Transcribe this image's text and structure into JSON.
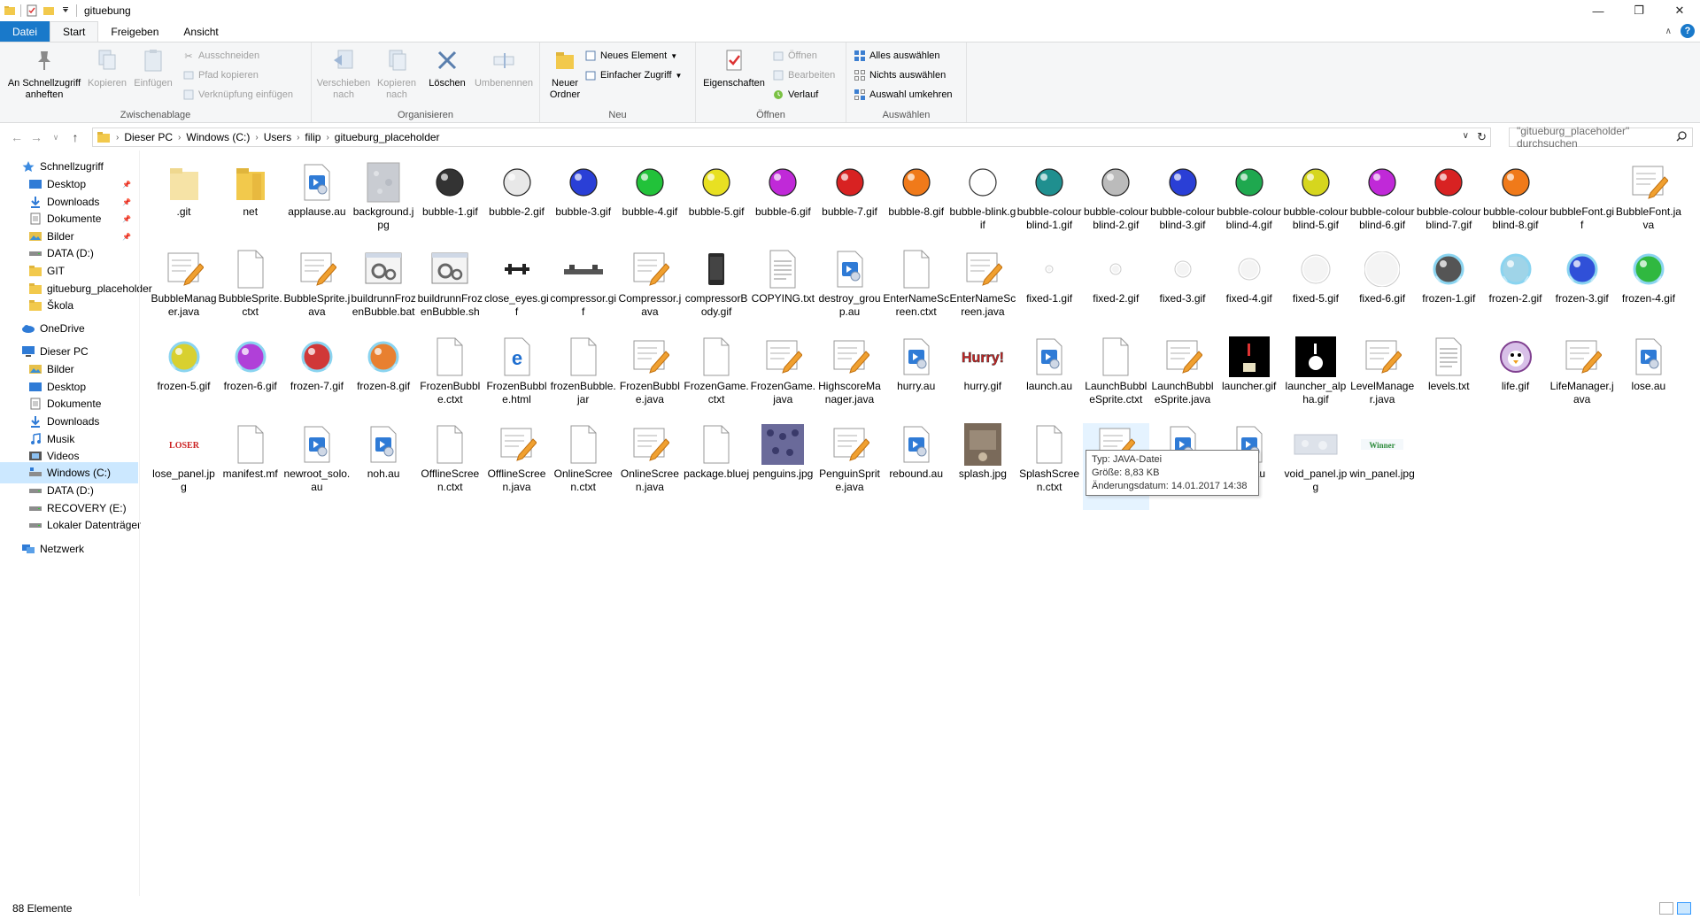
{
  "window": {
    "title": "gituebung",
    "controls": [
      "—",
      "❐",
      "✕"
    ]
  },
  "tabs": [
    "Datei",
    "Start",
    "Freigeben",
    "Ansicht"
  ],
  "ribbon": {
    "clipboard": {
      "name": "Zwischenablage",
      "pin": "An Schnellzugriff anheften",
      "copy": "Kopieren",
      "paste": "Einfügen",
      "cut": "Ausschneiden",
      "copy_path": "Pfad kopieren",
      "paste_shortcut": "Verknüpfung einfügen"
    },
    "organize": {
      "name": "Organisieren",
      "move": "Verschieben nach",
      "copyto": "Kopieren nach",
      "delete": "Löschen",
      "rename": "Umbenennen"
    },
    "new": {
      "name": "Neu",
      "new_folder": "Neuer Ordner",
      "new_item": "Neues Element",
      "easy_access": "Einfacher Zugriff"
    },
    "open": {
      "name": "Öffnen",
      "properties": "Eigenschaften",
      "open": "Öffnen",
      "edit": "Bearbeiten",
      "history": "Verlauf"
    },
    "select": {
      "name": "Auswählen",
      "all": "Alles auswählen",
      "none": "Nichts auswählen",
      "invert": "Auswahl umkehren"
    }
  },
  "address": {
    "crumbs": [
      "Dieser PC",
      "Windows (C:)",
      "Users",
      "filip",
      "gitueburg_placeholder"
    ],
    "search_placeholder": "\"gitueburg_placeholder\" durchsuchen"
  },
  "nav": [
    {
      "label": "Schnellzugriff",
      "icon": "star-icon",
      "indent": 0,
      "pinned": false
    },
    {
      "label": "Desktop",
      "icon": "desktop-icon",
      "indent": 1,
      "pinned": true
    },
    {
      "label": "Downloads",
      "icon": "download-icon",
      "indent": 1,
      "pinned": true
    },
    {
      "label": "Dokumente",
      "icon": "document-icon",
      "indent": 1,
      "pinned": true
    },
    {
      "label": "Bilder",
      "icon": "pictures-icon",
      "indent": 1,
      "pinned": true
    },
    {
      "label": "DATA (D:)",
      "icon": "drive-icon",
      "indent": 1,
      "pinned": false
    },
    {
      "label": "GIT",
      "icon": "folder-icon",
      "indent": 1,
      "pinned": false
    },
    {
      "label": "gitueburg_placeholder",
      "icon": "folder-icon",
      "indent": 1,
      "pinned": false
    },
    {
      "label": "Škola",
      "icon": "folder-icon",
      "indent": 1,
      "pinned": false
    },
    {
      "label": "OneDrive",
      "icon": "cloud-icon",
      "indent": 0,
      "pinned": false
    },
    {
      "label": "Dieser PC",
      "icon": "pc-icon",
      "indent": 0,
      "pinned": false
    },
    {
      "label": "Bilder",
      "icon": "pictures-icon",
      "indent": 1,
      "pinned": false
    },
    {
      "label": "Desktop",
      "icon": "desktop-icon",
      "indent": 1,
      "pinned": false
    },
    {
      "label": "Dokumente",
      "icon": "document-icon",
      "indent": 1,
      "pinned": false
    },
    {
      "label": "Downloads",
      "icon": "download-icon",
      "indent": 1,
      "pinned": false
    },
    {
      "label": "Musik",
      "icon": "music-icon",
      "indent": 1,
      "pinned": false
    },
    {
      "label": "Videos",
      "icon": "video-icon",
      "indent": 1,
      "pinned": false
    },
    {
      "label": "Windows (C:)",
      "icon": "windows-drive-icon",
      "indent": 1,
      "pinned": false,
      "selected": true
    },
    {
      "label": "DATA (D:)",
      "icon": "drive-icon",
      "indent": 1,
      "pinned": false
    },
    {
      "label": "RECOVERY (E:)",
      "icon": "drive-icon",
      "indent": 1,
      "pinned": false
    },
    {
      "label": "Lokaler Datenträger",
      "icon": "drive-icon",
      "indent": 1,
      "pinned": false
    },
    {
      "label": "Netzwerk",
      "icon": "network-icon",
      "indent": 0,
      "pinned": false
    }
  ],
  "files": [
    {
      "name": ".git",
      "icon": "folder-faded"
    },
    {
      "name": "net",
      "icon": "folder"
    },
    {
      "name": "applause.au",
      "icon": "audio"
    },
    {
      "name": "background.jpg",
      "icon": "texture"
    },
    {
      "name": "bubble-1.gif",
      "icon": "bubble",
      "color": "#333333"
    },
    {
      "name": "bubble-2.gif",
      "icon": "bubble",
      "color": "#e8e8e8"
    },
    {
      "name": "bubble-3.gif",
      "icon": "bubble",
      "color": "#2a3fd6"
    },
    {
      "name": "bubble-4.gif",
      "icon": "bubble",
      "color": "#22c23a"
    },
    {
      "name": "bubble-5.gif",
      "icon": "bubble",
      "color": "#e8e022"
    },
    {
      "name": "bubble-6.gif",
      "icon": "bubble",
      "color": "#c029d8"
    },
    {
      "name": "bubble-7.gif",
      "icon": "bubble",
      "color": "#d82222"
    },
    {
      "name": "bubble-8.gif",
      "icon": "bubble",
      "color": "#f07a1a"
    },
    {
      "name": "bubble-blink.gif",
      "icon": "ring",
      "color": "#333333"
    },
    {
      "name": "bubble-colourblind-1.gif",
      "icon": "bubble",
      "color": "#1f8f8f"
    },
    {
      "name": "bubble-colourblind-2.gif",
      "icon": "bubble",
      "color": "#bbbbbb"
    },
    {
      "name": "bubble-colourblind-3.gif",
      "icon": "bubble",
      "color": "#2a3fd6"
    },
    {
      "name": "bubble-colourblind-4.gif",
      "icon": "bubble",
      "color": "#1fa84f"
    },
    {
      "name": "bubble-colourblind-5.gif",
      "icon": "bubble",
      "color": "#d6d61e"
    },
    {
      "name": "bubble-colourblind-6.gif",
      "icon": "bubble",
      "color": "#c029d8"
    },
    {
      "name": "bubble-colourblind-7.gif",
      "icon": "bubble",
      "color": "#d82222"
    },
    {
      "name": "bubble-colourblind-8.gif",
      "icon": "bubble",
      "color": "#f07a1a"
    },
    {
      "name": "bubbleFont.gif",
      "icon": "blank"
    },
    {
      "name": "BubbleFont.java",
      "icon": "java"
    },
    {
      "name": "BubbleManager.java",
      "icon": "java"
    },
    {
      "name": "BubbleSprite.ctxt",
      "icon": "doc"
    },
    {
      "name": "BubbleSprite.java",
      "icon": "java"
    },
    {
      "name": "buildrunnFrozenBubble.bat",
      "icon": "gear"
    },
    {
      "name": "buildrunnFrozenBubble.sh",
      "icon": "gear"
    },
    {
      "name": "close_eyes.gif",
      "icon": "eyes"
    },
    {
      "name": "compressor.gif",
      "icon": "compressor"
    },
    {
      "name": "Compressor.java",
      "icon": "java"
    },
    {
      "name": "compressorBody.gif",
      "icon": "phone"
    },
    {
      "name": "COPYING.txt",
      "icon": "txt"
    },
    {
      "name": "destroy_group.au",
      "icon": "audio"
    },
    {
      "name": "EnterNameScreen.ctxt",
      "icon": "doc"
    },
    {
      "name": "EnterNameScreen.java",
      "icon": "java"
    },
    {
      "name": "fixed-1.gif",
      "icon": "dot",
      "size": 4
    },
    {
      "name": "fixed-2.gif",
      "icon": "dot",
      "size": 6
    },
    {
      "name": "fixed-3.gif",
      "icon": "dot",
      "size": 9
    },
    {
      "name": "fixed-4.gif",
      "icon": "dot",
      "size": 12
    },
    {
      "name": "fixed-5.gif",
      "icon": "dot",
      "size": 16
    },
    {
      "name": "fixed-6.gif",
      "icon": "dot",
      "size": 20
    },
    {
      "name": "frozen-1.gif",
      "icon": "frozen",
      "color": "#555555"
    },
    {
      "name": "frozen-2.gif",
      "icon": "frozen",
      "color": "#9fd4e8"
    },
    {
      "name": "frozen-3.gif",
      "icon": "frozen",
      "color": "#3050d8"
    },
    {
      "name": "frozen-4.gif",
      "icon": "frozen",
      "color": "#30b840"
    },
    {
      "name": "frozen-5.gif",
      "icon": "frozen",
      "color": "#d8d030"
    },
    {
      "name": "frozen-6.gif",
      "icon": "frozen",
      "color": "#b040d8"
    },
    {
      "name": "frozen-7.gif",
      "icon": "frozen",
      "color": "#d03838"
    },
    {
      "name": "frozen-8.gif",
      "icon": "frozen",
      "color": "#e88030"
    },
    {
      "name": "FrozenBubble.ctxt",
      "icon": "doc"
    },
    {
      "name": "FrozenBubble.html",
      "icon": "edge"
    },
    {
      "name": "frozenBubble.jar",
      "icon": "doc"
    },
    {
      "name": "FrozenBubble.java",
      "icon": "java"
    },
    {
      "name": "FrozenGame.ctxt",
      "icon": "doc"
    },
    {
      "name": "FrozenGame.java",
      "icon": "java"
    },
    {
      "name": "HighscoreManager.java",
      "icon": "java"
    },
    {
      "name": "hurry.au",
      "icon": "audio"
    },
    {
      "name": "hurry.gif",
      "icon": "hurry"
    },
    {
      "name": "launch.au",
      "icon": "audio"
    },
    {
      "name": "LaunchBubbleSprite.ctxt",
      "icon": "doc"
    },
    {
      "name": "LaunchBubbleSprite.java",
      "icon": "java"
    },
    {
      "name": "launcher.gif",
      "icon": "launcher"
    },
    {
      "name": "launcher_alpha.gif",
      "icon": "launcher-alpha"
    },
    {
      "name": "LevelManager.java",
      "icon": "java"
    },
    {
      "name": "levels.txt",
      "icon": "txt"
    },
    {
      "name": "life.gif",
      "icon": "life"
    },
    {
      "name": "LifeManager.java",
      "icon": "java"
    },
    {
      "name": "lose.au",
      "icon": "audio"
    },
    {
      "name": "lose_panel.jpg",
      "icon": "loser"
    },
    {
      "name": "manifest.mf",
      "icon": "doc"
    },
    {
      "name": "newroot_solo.au",
      "icon": "audio"
    },
    {
      "name": "noh.au",
      "icon": "audio"
    },
    {
      "name": "OfflineScreen.ctxt",
      "icon": "doc"
    },
    {
      "name": "OfflineScreen.java",
      "icon": "java"
    },
    {
      "name": "OnlineScreen.ctxt",
      "icon": "doc"
    },
    {
      "name": "OnlineScreen.java",
      "icon": "java"
    },
    {
      "name": "package.bluej",
      "icon": "doc"
    },
    {
      "name": "penguins.jpg",
      "icon": "penguins"
    },
    {
      "name": "PenguinSprite.java",
      "icon": "java"
    },
    {
      "name": "rebound.au",
      "icon": "audio"
    },
    {
      "name": "splash.jpg",
      "icon": "splash"
    },
    {
      "name": "SplashScreen.ctxt",
      "icon": "doc"
    },
    {
      "name": "",
      "icon": "java",
      "hover": true
    },
    {
      "name": "",
      "icon": "audio"
    },
    {
      "name": "...er.au",
      "icon": "audio"
    },
    {
      "name": "void_panel.jpg",
      "icon": "void"
    },
    {
      "name": "win_panel.jpg",
      "icon": "winner"
    }
  ],
  "tooltip": {
    "type": "Typ: JAVA-Datei",
    "size": "Größe: 8,83 KB",
    "date": "Änderungsdatum: 14.01.2017 14:38"
  },
  "status": {
    "count": "88 Elemente"
  }
}
